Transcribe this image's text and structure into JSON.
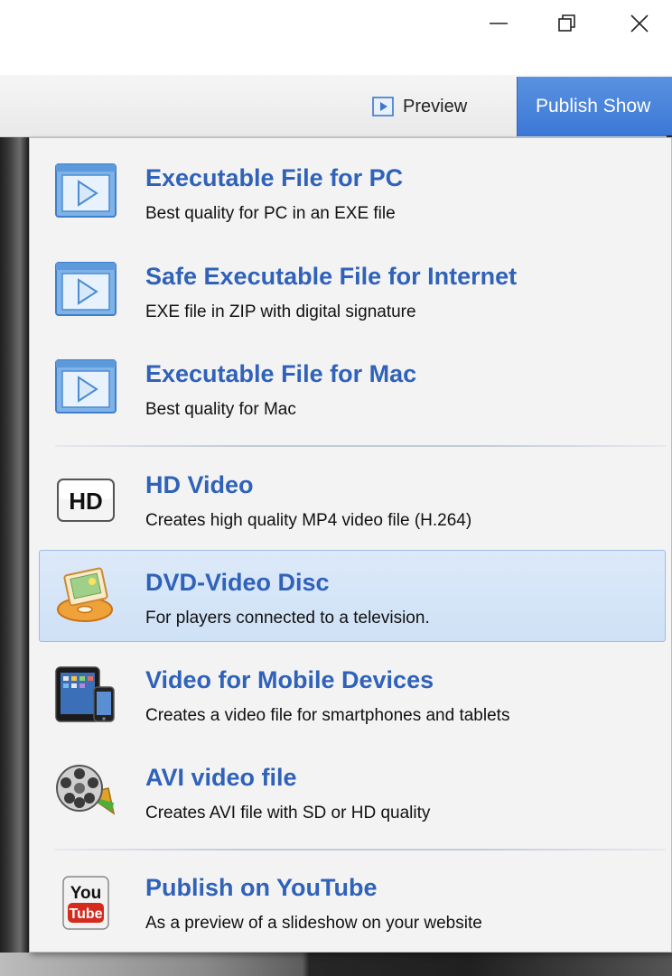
{
  "window": {
    "minimize_icon": "minimize-icon",
    "restore_icon": "restore-icon",
    "close_icon": "close-icon"
  },
  "toolbar": {
    "preview_label": "Preview",
    "publish_label": "Publish Show",
    "accent_color": "#3b77d6"
  },
  "menu": {
    "items": [
      {
        "title": "Executable File for PC",
        "desc": "Best quality for PC in an EXE file",
        "icon": "app-window-play-icon"
      },
      {
        "title": "Safe Executable File for Internet",
        "desc": "EXE file in ZIP with digital signature",
        "icon": "app-window-play-icon"
      },
      {
        "title": "Executable File for Mac",
        "desc": "Best quality for Mac",
        "icon": "app-window-play-icon"
      },
      {
        "title": "HD Video",
        "desc": "Creates high quality MP4 video file (H.264)",
        "icon": "hd-icon",
        "icon_text": "HD"
      },
      {
        "title": "DVD-Video Disc",
        "desc": "For players connected to a television.",
        "icon": "dvd-disc-icon",
        "selected": true
      },
      {
        "title": "Video for Mobile Devices",
        "desc": "Creates a video file for smartphones and tablets",
        "icon": "mobile-devices-icon"
      },
      {
        "title": "AVI video file",
        "desc": "Creates AVI file with SD or HD quality",
        "icon": "film-reel-icon"
      },
      {
        "title": "Publish on YouTube",
        "desc": "As a preview of a slideshow on your website",
        "icon": "youtube-icon",
        "icon_text_top": "You",
        "icon_text_bottom": "Tube"
      }
    ],
    "title_color": "#2f62b8",
    "selected_bg": "#d6e6f8"
  }
}
